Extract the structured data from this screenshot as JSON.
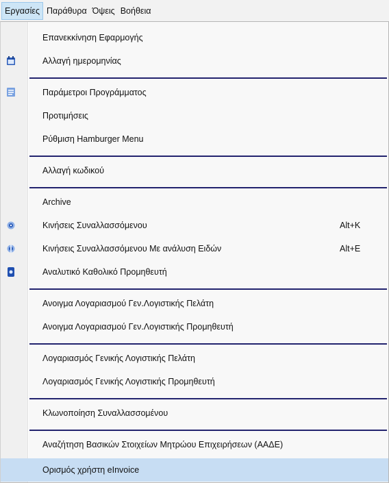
{
  "menubar": {
    "items": [
      {
        "label": "Εργασίες",
        "active": true
      },
      {
        "label": "Παράθυρα",
        "active": false
      },
      {
        "label": "Όψεις",
        "active": false
      },
      {
        "label": "Βοήθεια",
        "active": false
      }
    ]
  },
  "menu": {
    "items": [
      {
        "label": "Επανεκκίνηση Εφαρμογής"
      },
      {
        "label": "Αλλαγή ημερομηνίας",
        "icon": "calendar-icon"
      },
      {
        "label": "Παράμετροι Προγράμματος",
        "icon": "settings-document-icon"
      },
      {
        "label": "Προτιμήσεις"
      },
      {
        "label": "Ρύθμιση Hamburger Menu"
      },
      {
        "label": "Αλλαγή κωδικού"
      },
      {
        "label": "Archive"
      },
      {
        "label": "Κινήσεις Συναλλασσόμενου",
        "icon": "transactions-icon",
        "shortcut": "Alt+K"
      },
      {
        "label": "Κινήσεις  Συναλλασσόμενου Με ανάλυση Ειδών",
        "icon": "transactions-items-icon",
        "shortcut": "Alt+E"
      },
      {
        "label": "Αναλυτικό Καθολικό Προμηθευτή",
        "icon": "ledger-icon"
      },
      {
        "label": "Ανοιγμα Λογαριασμού Γεν.Λογιστικής Πελάτη"
      },
      {
        "label": "Ανοιγμα Λογαριασμού Γεν.Λογιστικής Προμηθευτή"
      },
      {
        "label": "Λογαριασμός Γενικής Λογιστικής Πελάτη"
      },
      {
        "label": "Λογαριασμός Γενικής Λογιστικής Προμηθευτή"
      },
      {
        "label": "Κλωνοποίηση Συναλλασσομένου"
      },
      {
        "label": "Αναζήτηση Βασικών Στοιχείων Μητρώου Επιχειρήσεων (ΑΑΔΕ)"
      },
      {
        "label": "Ορισμός χρήστη eInvoice",
        "highlighted": true
      }
    ]
  },
  "colors": {
    "separator": "#22236e",
    "highlight": "#c7ddf3",
    "icon_blue": "#2a5bb8"
  }
}
